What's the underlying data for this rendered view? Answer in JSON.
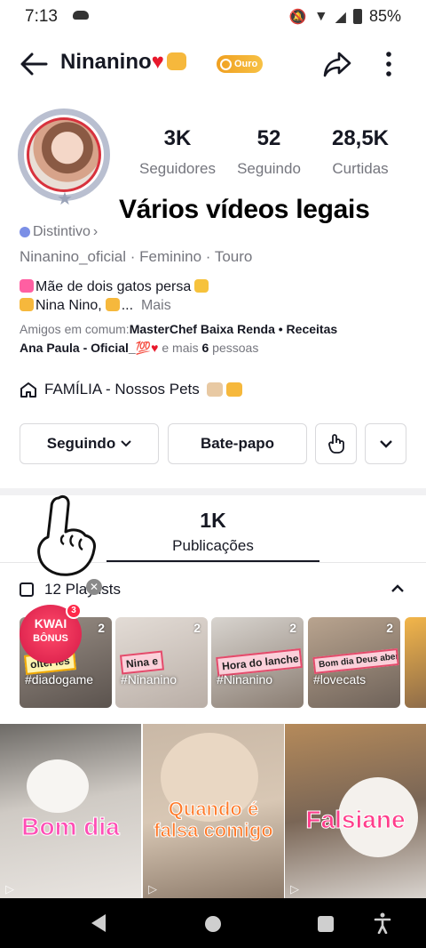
{
  "status_bar": {
    "time": "7:13",
    "battery": "85%"
  },
  "header": {
    "username": "Ninanino",
    "badge": "Ouro"
  },
  "profile": {
    "stats": [
      {
        "value": "3K",
        "label": "Seguidores"
      },
      {
        "value": "52",
        "label": "Seguindo"
      },
      {
        "value": "28,5K",
        "label": "Curtidas"
      }
    ],
    "banner_text": "Vários vídeos legais",
    "distintivo": "Distintivo",
    "meta_line": "Ninanino_oficial · Feminino · Touro",
    "bio_line1": "Mãe de dois gatos persa",
    "bio_line2": "Nina Nino,",
    "bio_more": "Mais",
    "friends_prefix": "Amigos em comum:",
    "friends_names1": "MasterChef Baixa Renda • Receitas",
    "friends_names2": "Ana Paula - Oficial_",
    "friends_suffix": " e mais ",
    "friends_count": "6",
    "friends_suffix2": " pessoas",
    "family_group": "FAMÍLIA - Nossos Pets"
  },
  "actions": {
    "following_label": "Seguindo",
    "chat_label": "Bate-papo"
  },
  "tabs": {
    "count": "1K",
    "label": "Publicações"
  },
  "playlists": {
    "header": "12 Playlists",
    "items": [
      {
        "count": "2",
        "sticker": "oltei les",
        "tag": "#diadogame"
      },
      {
        "count": "2",
        "sticker": "Nina e",
        "tag": "#Ninanino"
      },
      {
        "count": "2",
        "sticker": "Hora do lanche",
        "tag": "#Ninanino"
      },
      {
        "count": "2",
        "sticker": "Bom dia Deus abençoe",
        "tag": "#lovecats"
      }
    ],
    "kwai_label1": "KWAI",
    "kwai_label2": "BÔNUS",
    "kwai_badge": "3"
  },
  "videos": [
    {
      "caption": "Bom dia",
      "color": "#ff4fb6"
    },
    {
      "caption": "Quando é falsa comigo",
      "color": "#ff7a2a"
    },
    {
      "caption": "Falsiane",
      "color": "#ff3d8b"
    }
  ],
  "colors": {
    "accent": "#fe2c55",
    "ouro": "#f0a020",
    "text": "#161823",
    "secondary": "#75767e"
  }
}
